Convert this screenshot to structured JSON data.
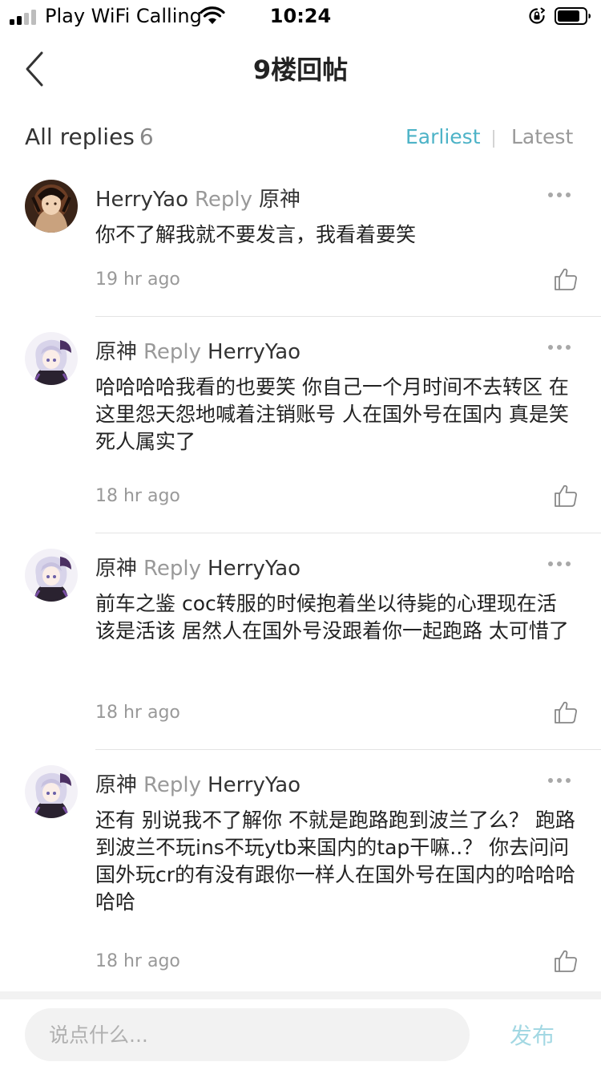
{
  "status_bar": {
    "carrier": "Play WiFi Calling",
    "time": "10:24"
  },
  "nav": {
    "title": "9楼回帖"
  },
  "replies_header": {
    "label": "All replies",
    "count": "6",
    "sort_earliest": "Earliest",
    "sort_latest": "Latest",
    "active_sort": "Earliest"
  },
  "replies": [
    {
      "author": "HerryYao",
      "reply_word": "Reply",
      "target": "原神",
      "text": "你不了解我就不要发言，我看着要笑",
      "time": "19 hr ago"
    },
    {
      "author": "原神",
      "reply_word": "Reply",
      "target": "HerryYao",
      "text": "哈哈哈哈我看的也要笑 你自己一个月时间不去转区 在这里怨天怨地喊着注销账号 人在国外号在国内 真是笑死人属实了",
      "time": "18 hr ago"
    },
    {
      "author": "原神",
      "reply_word": "Reply",
      "target": "HerryYao",
      "text": "前车之鉴 coc转服的时候抱着坐以待毙的心理现在活该是活该 居然人在国外号没跟着你一起跑路 太可惜了",
      "time": "18 hr ago"
    },
    {
      "author": "原神",
      "reply_word": "Reply",
      "target": "HerryYao",
      "text": "还有 别说我不了解你 不就是跑路跑到波兰了么？ 跑路到波兰不玩ins不玩ytb来国内的tap干嘛..？ 你去问问国外玩cr的有没有跟你一样人在国外号在国内的哈哈哈哈哈",
      "time": "18 hr ago"
    }
  ],
  "bottom_bar": {
    "input_placeholder": "说点什么...",
    "publish_label": "发布"
  },
  "colors": {
    "accent": "#4db3c7",
    "publish_disabled": "#a3d8e3",
    "muted_text": "#999999"
  }
}
